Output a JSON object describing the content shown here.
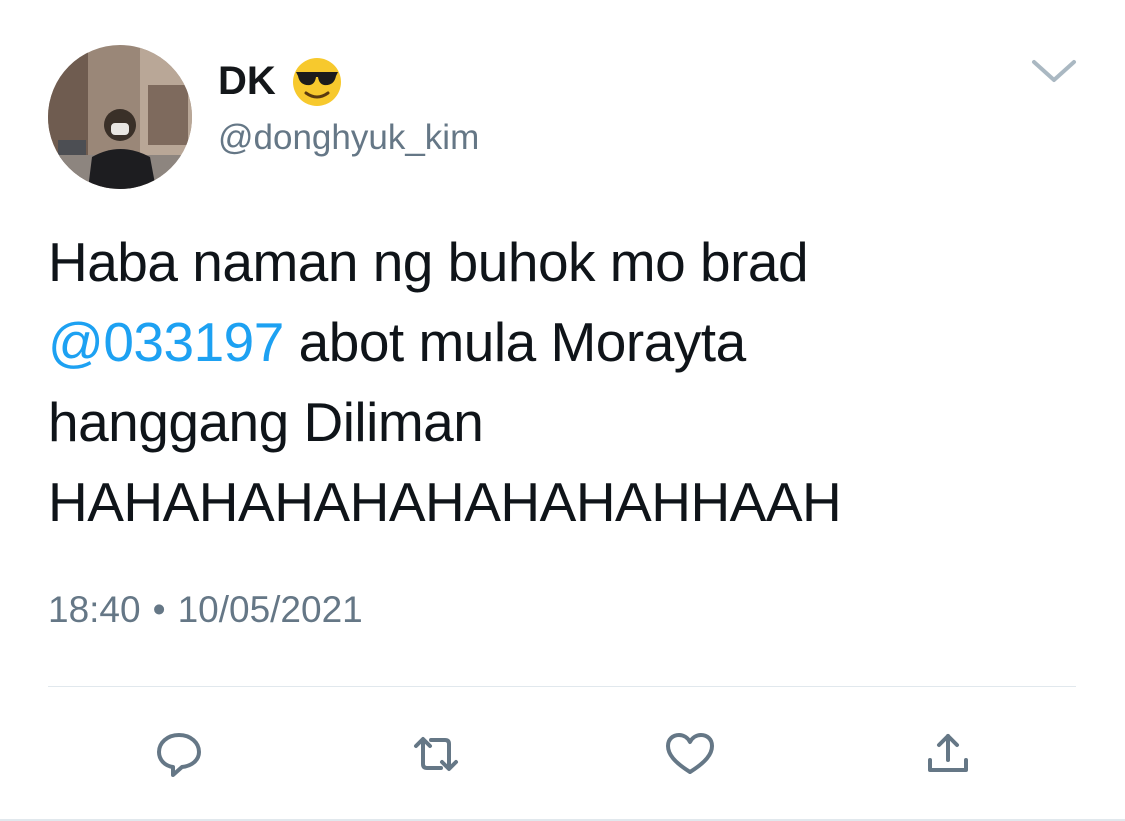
{
  "tweet": {
    "display_name": "DK",
    "name_emoji": "smiling-face-with-sunglasses",
    "handle": "@donghyuk_kim",
    "text_part1": "Haba naman ng buhok mo brad",
    "mention": "@033197",
    "text_part2": "abot mula Morayta",
    "text_line3": "hanggang Diliman",
    "text_line4": "HAHAHAHAHAHAHAHAHHAAH",
    "time": "18:40",
    "separator": "•",
    "date": "10/05/2021"
  },
  "icons": {
    "menu": "chevron-down-icon",
    "reply": "reply-icon",
    "retweet": "retweet-icon",
    "like": "heart-icon",
    "share": "share-icon"
  },
  "colors": {
    "mention": "#1da1f2",
    "secondary_text": "#657786",
    "icon": "#657786",
    "divider": "#e1e8ed"
  }
}
